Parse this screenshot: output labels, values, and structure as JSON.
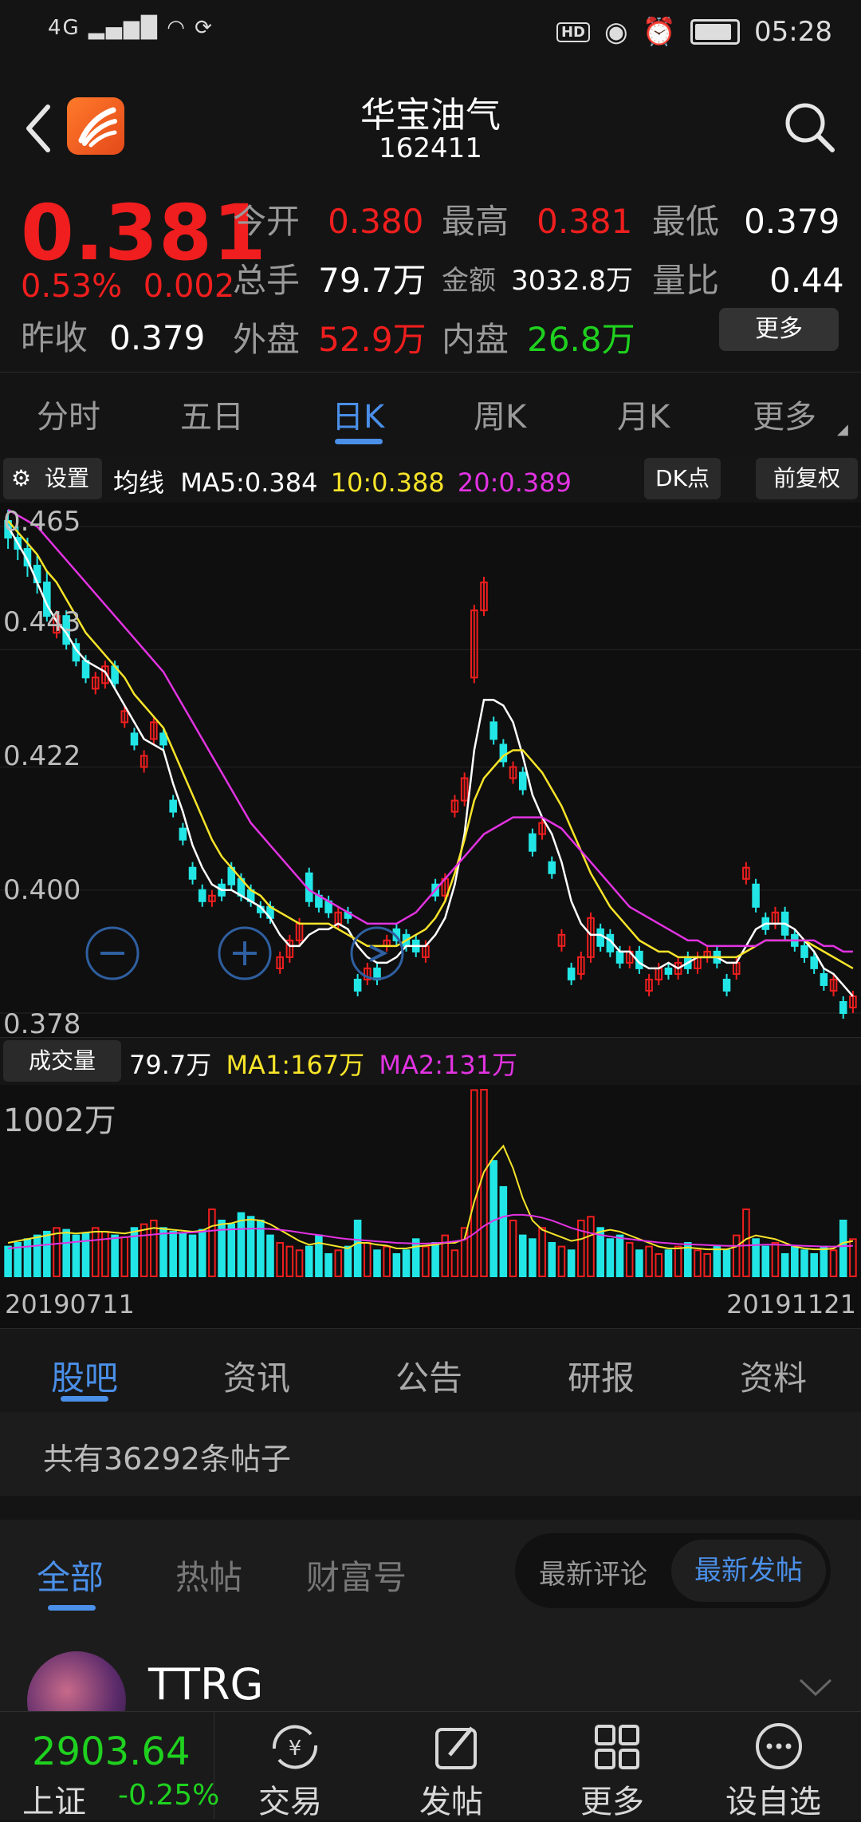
{
  "status_bar": {
    "network": "4G",
    "time": "05:28",
    "hd": "HD"
  },
  "header": {
    "title": "华宝油气",
    "code": "162411"
  },
  "quote": {
    "price": "0.381",
    "change_pct": "0.53%",
    "change": "0.002",
    "prev_close_label": "昨收",
    "prev_close": "0.379",
    "open_label": "今开",
    "open": "0.380",
    "high_label": "最高",
    "high": "0.381",
    "low_label": "最低",
    "low": "0.379",
    "volume_label": "总手",
    "volume": "79.7万",
    "amount_label": "金额",
    "amount": "3032.8万",
    "vol_ratio_label": "量比",
    "vol_ratio": "0.44",
    "outer_label": "外盘",
    "outer": "52.9万",
    "inner_label": "内盘",
    "inner": "26.8万",
    "more_button": "更多"
  },
  "chart_tabs": [
    {
      "label": "分时",
      "active": false
    },
    {
      "label": "五日",
      "active": false
    },
    {
      "label": "日K",
      "active": true
    },
    {
      "label": "周K",
      "active": false
    },
    {
      "label": "月K",
      "active": false
    },
    {
      "label": "更多",
      "active": false
    }
  ],
  "ma_bar": {
    "settings": "设置",
    "label": "均线",
    "ma5": "MA5:0.384",
    "ma10": "10:0.388",
    "ma20": "20:0.389",
    "dk_button": "DK点",
    "adjust_button": "前复权"
  },
  "volume_bar": {
    "label": "成交量",
    "value": "79.7万",
    "ma1": "MA1:167万",
    "ma2": "MA2:131万"
  },
  "colors": {
    "up": "#f01e1e",
    "down": "#22e6e6",
    "ma5": "#ffffff",
    "ma10": "#f7e42a",
    "ma20": "#e233e2",
    "accent": "#4a8fe8"
  },
  "chart_data": {
    "type": "candlestick",
    "y_ticks": [
      "0.465",
      "0.443",
      "0.422",
      "0.400",
      "0.378"
    ],
    "ylim": [
      0.378,
      0.465
    ],
    "x_start": "20190711",
    "x_end": "20191121",
    "volume_max_label": "1002万",
    "candles": [
      [
        0.466,
        0.463,
        0.468,
        0.461
      ],
      [
        0.463,
        0.461,
        0.465,
        0.459
      ],
      [
        0.461,
        0.458,
        0.463,
        0.456
      ],
      [
        0.458,
        0.455,
        0.46,
        0.453
      ],
      [
        0.455,
        0.449,
        0.457,
        0.448
      ],
      [
        0.446,
        0.449,
        0.45,
        0.445
      ],
      [
        0.449,
        0.444,
        0.45,
        0.443
      ],
      [
        0.444,
        0.441,
        0.445,
        0.44
      ],
      [
        0.441,
        0.438,
        0.442,
        0.437
      ],
      [
        0.436,
        0.438,
        0.439,
        0.435
      ],
      [
        0.437,
        0.44,
        0.441,
        0.436
      ],
      [
        0.44,
        0.437,
        0.441,
        0.436
      ],
      [
        0.43,
        0.432,
        0.433,
        0.429
      ],
      [
        0.428,
        0.426,
        0.429,
        0.425
      ],
      [
        0.422,
        0.424,
        0.425,
        0.421
      ],
      [
        0.427,
        0.43,
        0.431,
        0.426
      ],
      [
        0.428,
        0.426,
        0.429,
        0.425
      ],
      [
        0.416,
        0.414,
        0.417,
        0.413
      ],
      [
        0.411,
        0.409,
        0.412,
        0.408
      ],
      [
        0.404,
        0.402,
        0.405,
        0.401
      ],
      [
        0.4,
        0.398,
        0.401,
        0.397
      ],
      [
        0.398,
        0.399,
        0.4,
        0.397
      ],
      [
        0.401,
        0.399,
        0.402,
        0.398
      ],
      [
        0.404,
        0.401,
        0.405,
        0.4
      ],
      [
        0.402,
        0.399,
        0.403,
        0.398
      ],
      [
        0.4,
        0.398,
        0.401,
        0.397
      ],
      [
        0.397,
        0.396,
        0.398,
        0.395
      ],
      [
        0.397,
        0.395,
        0.398,
        0.394
      ],
      [
        0.386,
        0.388,
        0.389,
        0.385
      ],
      [
        0.388,
        0.391,
        0.392,
        0.387
      ],
      [
        0.391,
        0.394,
        0.395,
        0.39
      ],
      [
        0.403,
        0.398,
        0.404,
        0.397
      ],
      [
        0.399,
        0.397,
        0.4,
        0.396
      ],
      [
        0.398,
        0.396,
        0.399,
        0.395
      ],
      [
        0.394,
        0.396,
        0.397,
        0.393
      ],
      [
        0.396,
        0.395,
        0.397,
        0.394
      ],
      [
        0.384,
        0.382,
        0.385,
        0.381
      ],
      [
        0.384,
        0.386,
        0.387,
        0.383
      ],
      [
        0.386,
        0.384,
        0.387,
        0.383
      ],
      [
        0.39,
        0.391,
        0.392,
        0.389
      ],
      [
        0.393,
        0.391,
        0.394,
        0.39
      ],
      [
        0.392,
        0.39,
        0.393,
        0.389
      ],
      [
        0.391,
        0.389,
        0.392,
        0.388
      ],
      [
        0.388,
        0.39,
        0.391,
        0.387
      ],
      [
        0.401,
        0.399,
        0.402,
        0.398
      ],
      [
        0.399,
        0.402,
        0.403,
        0.398
      ],
      [
        0.414,
        0.416,
        0.417,
        0.413
      ],
      [
        0.416,
        0.42,
        0.421,
        0.415
      ],
      [
        0.438,
        0.45,
        0.451,
        0.437
      ],
      [
        0.45,
        0.455,
        0.456,
        0.449
      ],
      [
        0.43,
        0.427,
        0.431,
        0.426
      ],
      [
        0.426,
        0.423,
        0.427,
        0.422
      ],
      [
        0.42,
        0.422,
        0.423,
        0.419
      ],
      [
        0.421,
        0.418,
        0.422,
        0.417
      ],
      [
        0.41,
        0.407,
        0.411,
        0.406
      ],
      [
        0.41,
        0.412,
        0.413,
        0.409
      ],
      [
        0.405,
        0.403,
        0.406,
        0.402
      ],
      [
        0.39,
        0.392,
        0.393,
        0.389
      ],
      [
        0.386,
        0.384,
        0.387,
        0.383
      ],
      [
        0.385,
        0.388,
        0.389,
        0.384
      ],
      [
        0.388,
        0.395,
        0.396,
        0.387
      ],
      [
        0.393,
        0.39,
        0.394,
        0.389
      ],
      [
        0.392,
        0.389,
        0.393,
        0.388
      ],
      [
        0.389,
        0.387,
        0.39,
        0.386
      ],
      [
        0.387,
        0.389,
        0.39,
        0.386
      ],
      [
        0.389,
        0.386,
        0.39,
        0.385
      ],
      [
        0.382,
        0.384,
        0.385,
        0.381
      ],
      [
        0.384,
        0.386,
        0.387,
        0.383
      ],
      [
        0.386,
        0.385,
        0.387,
        0.384
      ],
      [
        0.385,
        0.387,
        0.388,
        0.384
      ],
      [
        0.388,
        0.386,
        0.389,
        0.385
      ],
      [
        0.386,
        0.388,
        0.389,
        0.385
      ],
      [
        0.388,
        0.389,
        0.39,
        0.387
      ],
      [
        0.389,
        0.387,
        0.39,
        0.386
      ],
      [
        0.384,
        0.382,
        0.385,
        0.381
      ],
      [
        0.385,
        0.387,
        0.388,
        0.384
      ],
      [
        0.402,
        0.404,
        0.405,
        0.401
      ],
      [
        0.401,
        0.397,
        0.402,
        0.396
      ],
      [
        0.395,
        0.393,
        0.396,
        0.392
      ],
      [
        0.394,
        0.396,
        0.397,
        0.393
      ],
      [
        0.396,
        0.392,
        0.397,
        0.391
      ],
      [
        0.392,
        0.39,
        0.393,
        0.389
      ],
      [
        0.39,
        0.388,
        0.391,
        0.387
      ],
      [
        0.388,
        0.386,
        0.389,
        0.385
      ],
      [
        0.385,
        0.383,
        0.386,
        0.382
      ],
      [
        0.382,
        0.384,
        0.385,
        0.381
      ],
      [
        0.38,
        0.378,
        0.381,
        0.377
      ],
      [
        0.379,
        0.381,
        0.382,
        0.378
      ]
    ],
    "ma5": [
      0.465,
      0.462,
      0.459,
      0.455,
      0.451,
      0.448,
      0.446,
      0.443,
      0.441,
      0.44,
      0.439,
      0.436,
      0.433,
      0.43,
      0.427,
      0.426,
      0.425,
      0.419,
      0.414,
      0.408,
      0.404,
      0.401,
      0.4,
      0.4,
      0.399,
      0.398,
      0.397,
      0.395,
      0.392,
      0.39,
      0.39,
      0.392,
      0.393,
      0.393,
      0.394,
      0.393,
      0.39,
      0.388,
      0.387,
      0.387,
      0.388,
      0.39,
      0.39,
      0.39,
      0.392,
      0.395,
      0.401,
      0.41,
      0.425,
      0.434,
      0.434,
      0.433,
      0.43,
      0.424,
      0.417,
      0.413,
      0.41,
      0.405,
      0.398,
      0.394,
      0.392,
      0.392,
      0.391,
      0.389,
      0.389,
      0.387,
      0.386,
      0.386,
      0.387,
      0.386,
      0.387,
      0.388,
      0.388,
      0.388,
      0.387,
      0.387,
      0.39,
      0.393,
      0.394,
      0.394,
      0.394,
      0.393,
      0.391,
      0.389,
      0.386,
      0.385,
      0.383,
      0.381
    ],
    "ma10": [
      0.466,
      0.464,
      0.462,
      0.46,
      0.457,
      0.455,
      0.452,
      0.449,
      0.446,
      0.444,
      0.442,
      0.44,
      0.438,
      0.435,
      0.433,
      0.431,
      0.429,
      0.425,
      0.421,
      0.417,
      0.413,
      0.409,
      0.406,
      0.404,
      0.402,
      0.4,
      0.399,
      0.397,
      0.396,
      0.395,
      0.394,
      0.394,
      0.394,
      0.394,
      0.393,
      0.392,
      0.391,
      0.39,
      0.39,
      0.39,
      0.39,
      0.391,
      0.392,
      0.393,
      0.395,
      0.398,
      0.403,
      0.409,
      0.416,
      0.42,
      0.422,
      0.424,
      0.425,
      0.425,
      0.423,
      0.421,
      0.418,
      0.415,
      0.411,
      0.407,
      0.403,
      0.4,
      0.397,
      0.395,
      0.393,
      0.391,
      0.39,
      0.389,
      0.389,
      0.388,
      0.388,
      0.388,
      0.388,
      0.388,
      0.388,
      0.388,
      0.389,
      0.39,
      0.391,
      0.391,
      0.391,
      0.391,
      0.391,
      0.39,
      0.389,
      0.388,
      0.387,
      0.386
    ],
    "ma20": [
      0.468,
      0.467,
      0.466,
      0.465,
      0.463,
      0.461,
      0.459,
      0.457,
      0.455,
      0.453,
      0.451,
      0.449,
      0.447,
      0.445,
      0.443,
      0.441,
      0.439,
      0.436,
      0.433,
      0.43,
      0.427,
      0.424,
      0.421,
      0.418,
      0.415,
      0.412,
      0.41,
      0.408,
      0.406,
      0.404,
      0.402,
      0.4,
      0.399,
      0.398,
      0.397,
      0.396,
      0.395,
      0.394,
      0.394,
      0.394,
      0.394,
      0.395,
      0.396,
      0.398,
      0.4,
      0.402,
      0.404,
      0.406,
      0.408,
      0.41,
      0.411,
      0.412,
      0.413,
      0.413,
      0.413,
      0.413,
      0.412,
      0.411,
      0.409,
      0.407,
      0.405,
      0.403,
      0.401,
      0.399,
      0.397,
      0.396,
      0.395,
      0.394,
      0.393,
      0.392,
      0.391,
      0.391,
      0.39,
      0.39,
      0.39,
      0.39,
      0.39,
      0.39,
      0.391,
      0.391,
      0.391,
      0.391,
      0.391,
      0.391,
      0.39,
      0.39,
      0.389,
      0.389
    ],
    "volumes": [
      160,
      180,
      200,
      220,
      240,
      260,
      250,
      220,
      230,
      260,
      240,
      220,
      210,
      260,
      280,
      300,
      260,
      240,
      230,
      220,
      250,
      360,
      300,
      280,
      340,
      320,
      300,
      220,
      180,
      160,
      140,
      160,
      220,
      120,
      140,
      160,
      300,
      180,
      140,
      160,
      120,
      140,
      200,
      160,
      180,
      220,
      140,
      260,
      1000,
      1002,
      620,
      480,
      300,
      220,
      200,
      260,
      180,
      160,
      140,
      300,
      320,
      260,
      200,
      220,
      180,
      140,
      160,
      120,
      140,
      160,
      180,
      140,
      120,
      160,
      140,
      220,
      360,
      200,
      160,
      180,
      120,
      160,
      140,
      120,
      160,
      140,
      300,
      200
    ],
    "vol_ma1": [
      180,
      190,
      200,
      210,
      220,
      230,
      235,
      230,
      235,
      240,
      240,
      235,
      230,
      240,
      250,
      260,
      255,
      250,
      245,
      240,
      245,
      270,
      280,
      285,
      300,
      305,
      300,
      280,
      250,
      220,
      190,
      170,
      180,
      170,
      160,
      150,
      180,
      180,
      170,
      165,
      150,
      150,
      160,
      165,
      170,
      180,
      180,
      200,
      400,
      560,
      640,
      700,
      580,
      420,
      300,
      250,
      230,
      210,
      190,
      200,
      220,
      240,
      250,
      240,
      220,
      200,
      180,
      160,
      150,
      150,
      155,
      150,
      145,
      145,
      145,
      160,
      200,
      220,
      210,
      200,
      180,
      160,
      150,
      145,
      145,
      150,
      180,
      190
    ],
    "vol_ma2": [
      150,
      155,
      160,
      165,
      170,
      175,
      180,
      185,
      190,
      195,
      200,
      205,
      210,
      215,
      220,
      225,
      230,
      232,
      234,
      236,
      240,
      245,
      250,
      252,
      254,
      256,
      256,
      254,
      250,
      244,
      236,
      228,
      222,
      214,
      206,
      200,
      196,
      192,
      188,
      184,
      180,
      178,
      176,
      176,
      178,
      182,
      188,
      196,
      230,
      270,
      300,
      320,
      330,
      330,
      325,
      315,
      300,
      280,
      260,
      245,
      232,
      222,
      214,
      206,
      200,
      194,
      188,
      182,
      178,
      174,
      172,
      170,
      168,
      166,
      164,
      164,
      166,
      168,
      170,
      170,
      168,
      166,
      164,
      162,
      160,
      160,
      162,
      164
    ]
  },
  "info_tabs": [
    {
      "label": "股吧",
      "active": true
    },
    {
      "label": "资讯",
      "active": false
    },
    {
      "label": "公告",
      "active": false
    },
    {
      "label": "研报",
      "active": false
    },
    {
      "label": "资料",
      "active": false
    }
  ],
  "post_count": "共有36292条帖子",
  "filter_tabs": [
    {
      "label": "全部",
      "active": true
    },
    {
      "label": "热帖",
      "active": false
    },
    {
      "label": "财富号",
      "active": false
    }
  ],
  "sort": {
    "left": "最新评论",
    "right": "最新发帖"
  },
  "post": {
    "author": "TTRG"
  },
  "index_ticker": {
    "value": "2903.64",
    "name": "上证",
    "change": "-0.25%"
  },
  "bottom_nav": [
    {
      "label": "交易",
      "icon": "yen-refresh-icon"
    },
    {
      "label": "发帖",
      "icon": "edit-icon"
    },
    {
      "label": "更多",
      "icon": "grid-icon"
    },
    {
      "label": "设自选",
      "icon": "dots-icon"
    }
  ]
}
